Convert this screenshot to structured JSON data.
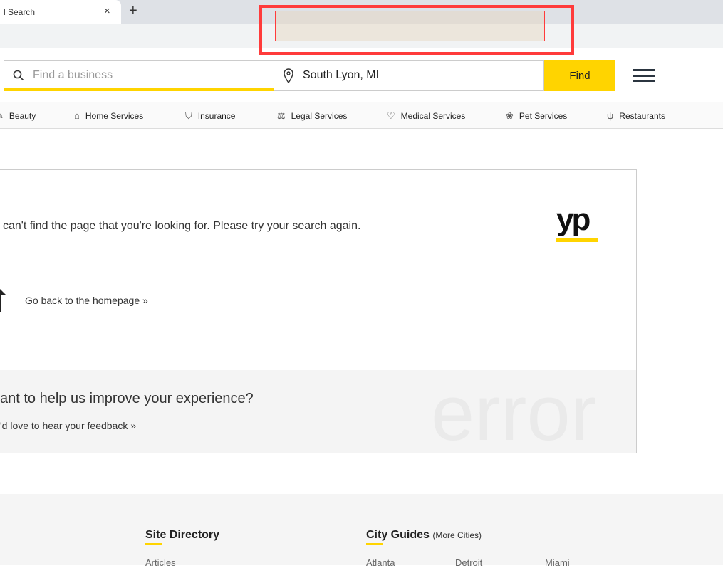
{
  "browser": {
    "tab_title": "l Search",
    "close": "×",
    "new_tab": "+"
  },
  "search": {
    "what_placeholder": "Find a business",
    "where_value": "South Lyon, MI",
    "find_label": "Find"
  },
  "categories": [
    "Beauty",
    "Home Services",
    "Insurance",
    "Legal Services",
    "Medical Services",
    "Pet Services",
    "Restaurants"
  ],
  "error": {
    "message": "can't find the page that you're looking for. Please try your search again.",
    "home_link": "Go back to the homepage »",
    "logo": "yp",
    "watermark": "error",
    "feedback_title": "ant to help us improve your experience?",
    "feedback_link": "'d love to hear your feedback »"
  },
  "footer": {
    "site_directory": "Site Directory",
    "city_guides": "City Guides",
    "more_cities": "(More Cities)",
    "links": [
      "Articles",
      "Atlanta",
      "Detroit",
      "Miami"
    ]
  },
  "colors": {
    "brand_yellow": "#ffd400"
  }
}
